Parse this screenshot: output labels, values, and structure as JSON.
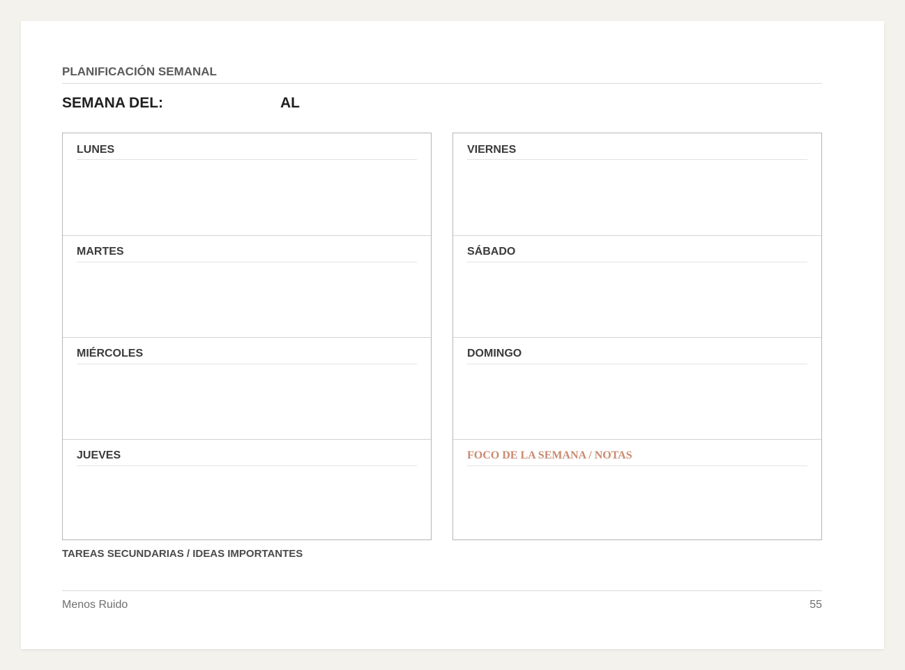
{
  "header": {
    "section_title": "PLANIFICACIÓN SEMANAL",
    "week_from_label": "SEMANA DEL:",
    "week_to_label": "AL"
  },
  "days_left": [
    {
      "label": "LUNES"
    },
    {
      "label": "MARTES"
    },
    {
      "label": "MIÉRCOLES"
    },
    {
      "label": "JUEVES"
    }
  ],
  "days_right": [
    {
      "label": "VIERNES"
    },
    {
      "label": "SÁBADO"
    },
    {
      "label": "DOMINGO"
    }
  ],
  "focus_box": {
    "label": "FOCO DE LA SEMANA / NOTAS",
    "color": "#c98a70"
  },
  "secondary": {
    "label": "TAREAS SECUNDARIAS / IDEAS IMPORTANTES"
  },
  "footer": {
    "brand": "Menos Ruido",
    "page_number": "55"
  }
}
